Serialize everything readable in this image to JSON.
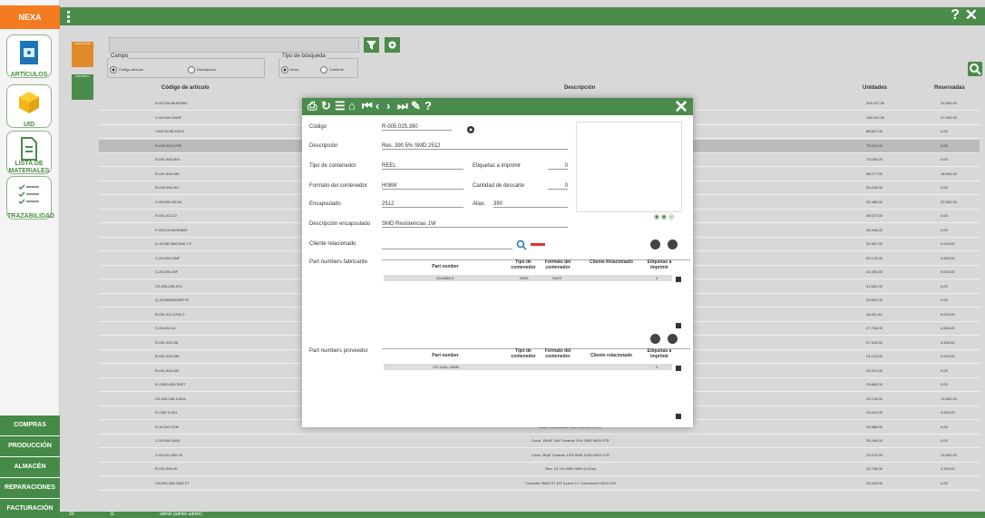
{
  "app": {
    "logo": "NEXA"
  },
  "sidebar": {
    "items": [
      {
        "label": "ARTÍCULOS",
        "icon": "articles-icon"
      },
      {
        "label": "UID",
        "icon": "box-icon"
      },
      {
        "label": "LISTA DE MATERIALES",
        "icon": "document-icon"
      },
      {
        "label": "TRAZABILIDAD",
        "icon": "checklist-icon"
      }
    ],
    "bottom": [
      "COMPRAS",
      "PRODUCCIÓN",
      "ALMACÉN",
      "REPARACIONES",
      "FACTURACIÓN"
    ]
  },
  "top": {
    "help": "?",
    "close": "✕"
  },
  "tiles": {
    "articulos": "ARTÍCULOS",
    "historial": "HISTORIAL"
  },
  "filters": {
    "campo_label": "Campo",
    "campo_opt1": "Código artículo",
    "campo_opt2": "Descripción",
    "tipo_label": "Tipo de búsqueda",
    "tipo_opt1": "Inicio",
    "tipo_opt2": "Contiene"
  },
  "table": {
    "headers": {
      "codigo": "Código de artículo",
      "descripcion": "Descripción",
      "unidades": "Unidades",
      "reservadas": "Reservadas"
    },
    "rows": [
      {
        "codigo": "D-25.315.MUR0360",
        "desc": "",
        "unidades": "305.207,00",
        "reservadas": "31.500,00"
      },
      {
        "codigo": "C-05.006.100NF",
        "desc": "",
        "unidades": "106.042,00",
        "reservadas": "27.000,00"
      },
      {
        "codigo": "I-000.00.55.XGLD",
        "desc": "",
        "unidades": "88.847,00",
        "reservadas": "0,00"
      },
      {
        "codigo": "R-005.025.470R",
        "desc": "",
        "unidades": "75.514,00",
        "reservadas": "0,00"
      },
      {
        "codigo": "R-001.006.5K6",
        "desc": "",
        "unidades": "70.005,00",
        "reservadas": "0,00"
      },
      {
        "codigo": "R-001.006.10K",
        "desc": "",
        "unidades": "58.177,00",
        "reservadas": "18.000,00"
      },
      {
        "codigo": "R-006.006.4K7",
        "desc": "",
        "unidades": "53.228,00",
        "reservadas": "0,00"
      },
      {
        "codigo": "C-05.008.10U16",
        "desc": "",
        "unidades": "42.486,00",
        "reservadas": "22.500,00"
      },
      {
        "codigo": "R-001.012.22",
        "desc": "",
        "unidades": "35.027,00",
        "reservadas": "0,00"
      },
      {
        "codigo": "P-005.10.MUR0805",
        "desc": "",
        "unidades": "34.945,00",
        "reservadas": "0,00"
      },
      {
        "codigo": "D-15.350.BAT42W-7-F",
        "desc": "",
        "unidades": "32.967,00",
        "reservadas": "9.000,00"
      },
      {
        "codigo": "C-05.006.10NF",
        "desc": "",
        "unidades": "32.178,00",
        "reservadas": "4.500,00"
      },
      {
        "codigo": "C-05.006.1NF",
        "desc": "",
        "unidades": "31.059,00",
        "reservadas": "9.000,00"
      },
      {
        "codigo": "CE-035.236.47U",
        "desc": "",
        "unidades": "31.602,00",
        "reservadas": "0,00"
      },
      {
        "codigo": "Q-25.BN6005S0PTS",
        "desc": "",
        "unidades": "29.603,00",
        "reservadas": "0,00"
      },
      {
        "codigo": "R-001.012.470K.0",
        "desc": "",
        "unidades": "28.811,00",
        "reservadas": "9.000,00"
      },
      {
        "codigo": "C-05.006.1U",
        "desc": "",
        "unidades": "27.706,00",
        "reservadas": "4.500,00"
      },
      {
        "codigo": "R-001.020.1M",
        "desc": "",
        "unidades": "27.343,00",
        "reservadas": "4.500,00"
      },
      {
        "codigo": "R-001.006.15K",
        "desc": "",
        "unidades": "24.122,00",
        "reservadas": "9.000,00"
      },
      {
        "codigo": "R-001.006.100",
        "desc": "",
        "unidades": "23.921,00",
        "reservadas": "0,00"
      },
      {
        "codigo": "IC-035.LM317MST",
        "desc": "",
        "unidades": "23.884,00",
        "reservadas": "0,00"
      },
      {
        "codigo": "CE-035.236.100UL",
        "desc": "",
        "unidades": "23.715,00",
        "reservadas": "13.500,00"
      },
      {
        "codigo": "IC-035.TL431",
        "desc": "",
        "unidades": "23.441,00",
        "reservadas": "4.500,00"
      },
      {
        "codigo": "D-10.310.S1M",
        "desc": "Diode Rectificador S1M SMA 1A 1000V",
        "unidades": "23.388,00",
        "reservadas": "0,00"
      },
      {
        "codigo": "C-05.006.150N",
        "desc": "Cond. 150nF 16V Ceramic 10% SMD 0603 X7R",
        "unidades": "25.284,00",
        "reservadas": "0,00"
      },
      {
        "codigo": "C-05.012.630.1K",
        "desc": "Cond. 1KpF Ceramic 10% SMD 1206 630V X7R",
        "unidades": "23.270,00",
        "reservadas": "13.500,00"
      },
      {
        "codigo": "R-001.006.1K",
        "desc": "Res. 1K 1% SMD 0603 (1/10w)",
        "unidades": "22.748,00",
        "reservadas": "3.300,00"
      },
      {
        "codigo": "CN-500.006.GMZ.ST",
        "desc": "Conector 06AS.ST (ST 6 pins C.I. Connecom+2622-203",
        "unidades": "22.443,00",
        "reservadas": "0,00"
      }
    ]
  },
  "modal": {
    "codigo_label": "Código",
    "codigo": "R-005.025.390",
    "descripcion_label": "Descripción",
    "descripcion": "Res. 390 5% SMD 2512",
    "tipo_label": "Tipo de contenedor",
    "tipo": "REEL",
    "etiquetas_label": "Etiquetas a imprimir",
    "etiquetas": "0",
    "formato_label": "Formato del contenedor",
    "formato": "H08W",
    "descarte_label": "Cantidad de descarte",
    "descarte": "0",
    "encapsulado_label": "Encapsulado",
    "encapsulado": "2512",
    "alias_label": "Alias",
    "alias": "390",
    "desc_encap_label": "Descripción encapsulado",
    "desc_encap": "SMD Resistencias 1W",
    "cliente_label": "Cliente relacionado",
    "pnf_label": "Part numbers fabricante",
    "pnp_label": "Part numbers proveedor",
    "pn_headers": {
      "part": "Part number",
      "tipo": "Tipo de contenedor",
      "formato": "Formato del contenedor",
      "cliente": "Cliente Relacionado",
      "etiq": "Etiquetas a imprimir"
    },
    "pnp_headers": {
      "part": "Part number",
      "tipo": "Tipo de contenedor",
      "formato": "Formato del contenedor",
      "cliente": "Cliente relacionado",
      "etiq": "Etiquetas a imprimir"
    },
    "pnf_row": {
      "part": "3344585-3",
      "tipo": "REEL",
      "formato": "H12S",
      "cliente": "",
      "etiq": "0"
    },
    "pnp_row": {
      "part": "CR-12A4--390R-",
      "tipo": "",
      "formato": "",
      "cliente": "",
      "etiq": "0"
    }
  },
  "status": {
    "filter": "20",
    "cal": "11",
    "user": "admin (admin admin)"
  }
}
